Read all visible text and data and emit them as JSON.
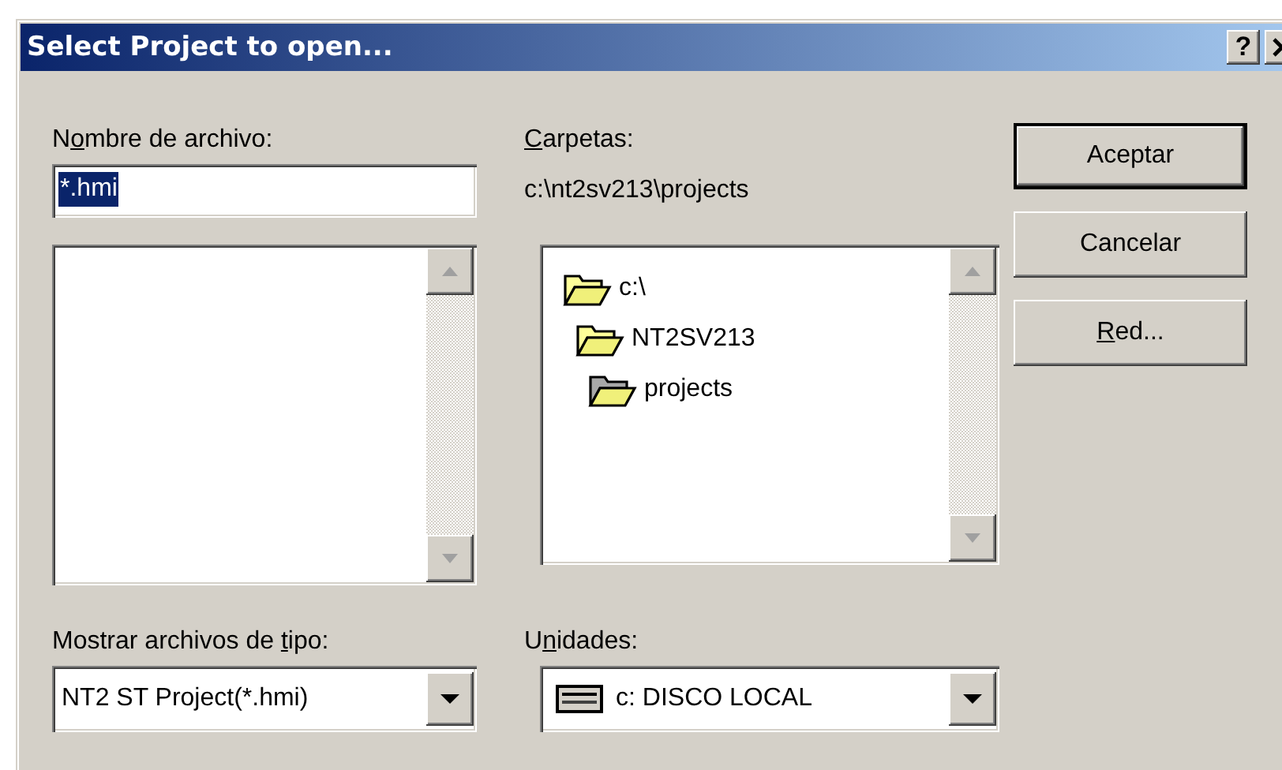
{
  "window": {
    "title": "Select Project to open...",
    "help_button": "?"
  },
  "file_name": {
    "label": {
      "pre": "N",
      "key": "o",
      "post": "mbre de archivo:"
    },
    "value": "*.hmi",
    "text_selected": true
  },
  "folders": {
    "label": {
      "key": "C",
      "post": "arpetas:"
    },
    "path": "c:\\nt2sv213\\projects",
    "tree": [
      {
        "name": "c:\\",
        "children": [
          {
            "name": "NT2SV213",
            "children": [
              {
                "name": "projects"
              }
            ]
          }
        ]
      }
    ]
  },
  "file_type": {
    "label": {
      "pre": "Mostrar archivos de ",
      "key": "t",
      "post": "ipo:"
    },
    "value": "NT2 ST Project(*.hmi)"
  },
  "drives": {
    "label": {
      "pre": "U",
      "key": "n",
      "post": "idades:"
    },
    "value": "c: DISCO LOCAL"
  },
  "buttons": [
    {
      "label": {
        "post": "Aceptar"
      },
      "default": true
    },
    {
      "label": {
        "post": "Cancelar"
      },
      "default": false
    },
    {
      "label": {
        "key": "R",
        "post": "ed..."
      },
      "default": false
    }
  ]
}
